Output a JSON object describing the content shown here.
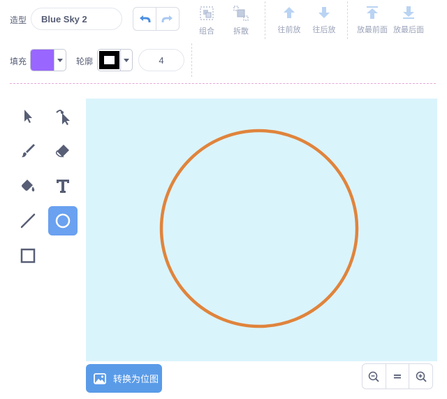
{
  "costume": {
    "label": "造型",
    "name": "Blue Sky 2"
  },
  "toolbar": {
    "group": "组合",
    "ungroup": "拆散",
    "forward": "往前放",
    "backward": "往后放",
    "front": "放最前面",
    "back": "放最后面"
  },
  "fill": {
    "label": "填充",
    "color": "#9966ff"
  },
  "outline": {
    "label": "轮廓",
    "color": "#000000",
    "width": "4"
  },
  "tools": {
    "select": "arrow-icon",
    "reshape": "reshape-icon",
    "brush": "brush-icon",
    "eraser": "eraser-icon",
    "fill": "fill-bucket-icon",
    "text": "text-icon",
    "line": "line-icon",
    "circle": "circle-icon",
    "rect": "rectangle-icon",
    "active": "circle"
  },
  "canvas": {
    "background": "#daf4fc",
    "shape": "circle",
    "stroke": "#e0843c"
  },
  "bottom": {
    "convert_label": "转换为位图"
  },
  "zoom": {
    "out": "zoom-out-icon",
    "reset": "=",
    "in": "zoom-in-icon"
  },
  "colors": {
    "accent": "#5a9be8",
    "text": "#575e75",
    "muted": "#9aa2b8"
  }
}
